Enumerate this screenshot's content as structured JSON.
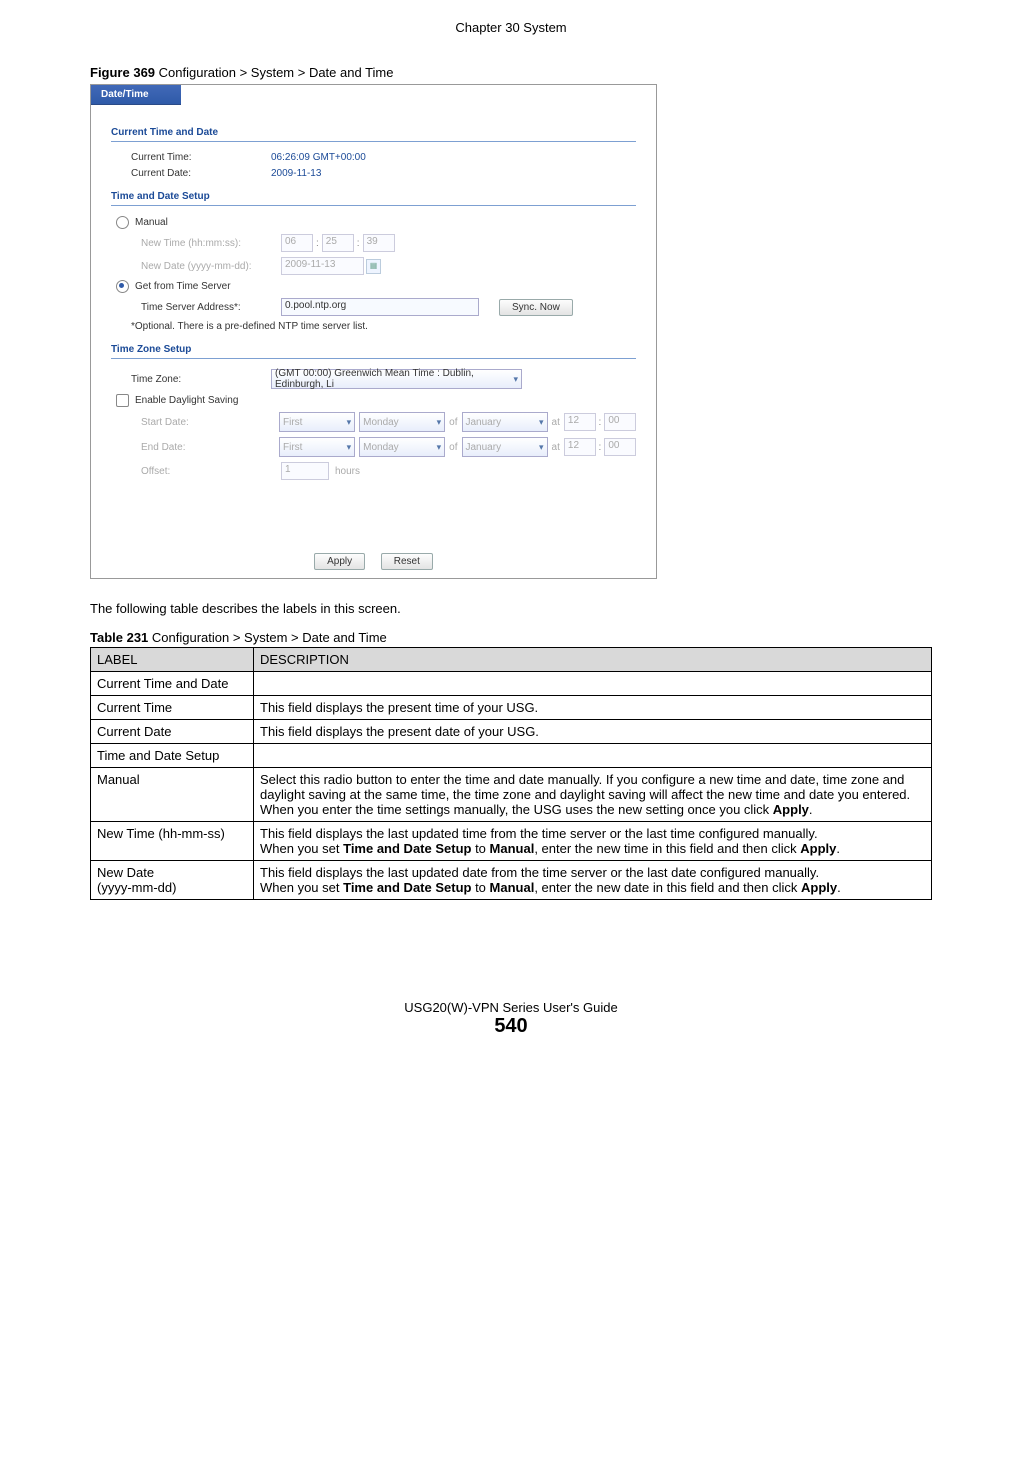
{
  "chapter_header": "Chapter 30 System",
  "figure_caption_bold": "Figure 369",
  "figure_caption_rest": "   Configuration > System > Date and Time",
  "screenshot": {
    "tab": "Date/Time",
    "section1": "Current Time and Date",
    "current_time_label": "Current Time:",
    "current_time_value": "06:26:09 GMT+00:00",
    "current_date_label": "Current Date:",
    "current_date_value": "2009-11-13",
    "section2": "Time and Date Setup",
    "manual_label": "Manual",
    "new_time_label": "New Time (hh:mm:ss):",
    "new_time_hh": "06",
    "new_time_mm": "25",
    "new_time_ss": "39",
    "new_date_label": "New Date (yyyy-mm-dd):",
    "new_date_value": "2009-11-13",
    "get_server_label": "Get from Time Server",
    "time_server_label": "Time Server Address*:",
    "time_server_value": "0.pool.ntp.org",
    "sync_now": "Sync. Now",
    "optional_note": "*Optional. There is a pre-defined NTP time server list.",
    "section3": "Time Zone Setup",
    "tz_label": "Time Zone:",
    "tz_value": "(GMT 00:00) Greenwich Mean Time : Dublin, Edinburgh, Li",
    "dst_label": "Enable Daylight Saving",
    "start_date_label": "Start Date:",
    "end_date_label": "End Date:",
    "week": "First",
    "day": "Monday",
    "of": "of",
    "month": "January",
    "at": "at",
    "h12": "12",
    "m00": "00",
    "offset_label": "Offset:",
    "offset_value": "1",
    "offset_unit": "hours",
    "apply": "Apply",
    "reset": "Reset"
  },
  "body_text": "The following table describes the labels in this screen.",
  "table_caption_bold": "Table 231",
  "table_caption_rest": "   Configuration > System > Date and Time",
  "table": {
    "header_label": "LABEL",
    "header_desc": "DESCRIPTION",
    "rows": [
      {
        "label": "Current Time and Date",
        "desc": ""
      },
      {
        "label": "Current Time",
        "desc": "This field displays the present time of your USG."
      },
      {
        "label": "Current Date",
        "desc": "This field displays the present date of your USG."
      },
      {
        "label": "Time and Date Setup",
        "desc": ""
      },
      {
        "label": "Manual",
        "desc": "Select this radio button to enter the time and date manually. If you configure a new time and date, time zone and daylight saving at the same time, the time zone and daylight saving will affect the new time and date you entered. When you enter the time settings manually, the USG uses the new setting once you click <b>Apply</b>."
      },
      {
        "label": "New Time (hh-mm-ss)",
        "desc": "This field displays the last updated time from the time server or the last time configured manually.<br>When you set <b>Time and Date Setup</b> to <b>Manual</b>, enter the new time in this field and then click <b>Apply</b>."
      },
      {
        "label": "New Date<br>(yyyy-mm-dd)",
        "desc": "This field displays the last updated date from the time server or the last date configured manually.<br>When you set <b>Time and Date Setup</b> to <b>Manual</b>, enter the new date in this field and then click <b>Apply</b>."
      }
    ]
  },
  "footer_guide": "USG20(W)-VPN Series User's Guide",
  "footer_page": "540"
}
